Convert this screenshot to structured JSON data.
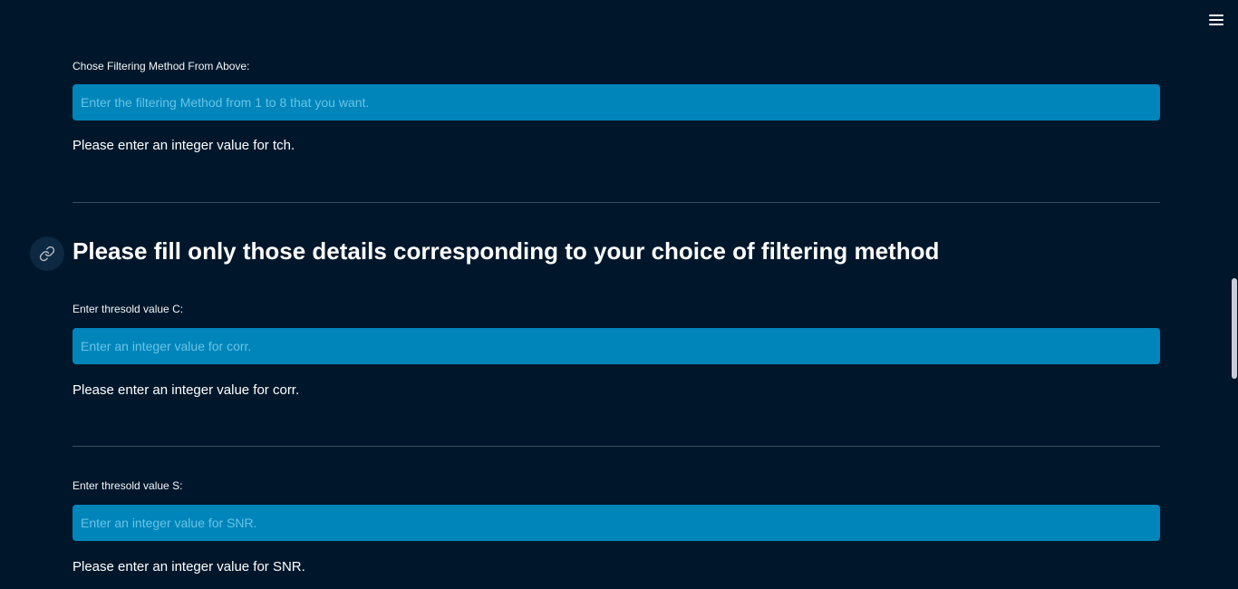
{
  "fields": [
    {
      "label": "Chose Filtering Method From Above:",
      "value": "",
      "placeholder": "Enter the filtering Method from 1 to 8 that you want.",
      "message": "Please enter an integer value for tch."
    },
    {
      "label": "Enter thresold value C:",
      "value": "",
      "placeholder": "Enter an integer value for corr.",
      "message": "Please enter an integer value for corr."
    },
    {
      "label": "Enter thresold value S:",
      "value": "",
      "placeholder": "Enter an integer value for SNR.",
      "message": "Please enter an integer value for SNR."
    }
  ],
  "section": {
    "heading": "Please fill only those details corresponding to your choice of filtering method",
    "anchor_icon": "link-icon"
  },
  "header": {
    "menu_icon": "hamburger-menu-icon"
  },
  "colors": {
    "background": "#00172b",
    "input_background": "#0085ba",
    "input_placeholder": "#68c3e6",
    "divider": "#3b4b5d",
    "text": "#ffffff"
  }
}
